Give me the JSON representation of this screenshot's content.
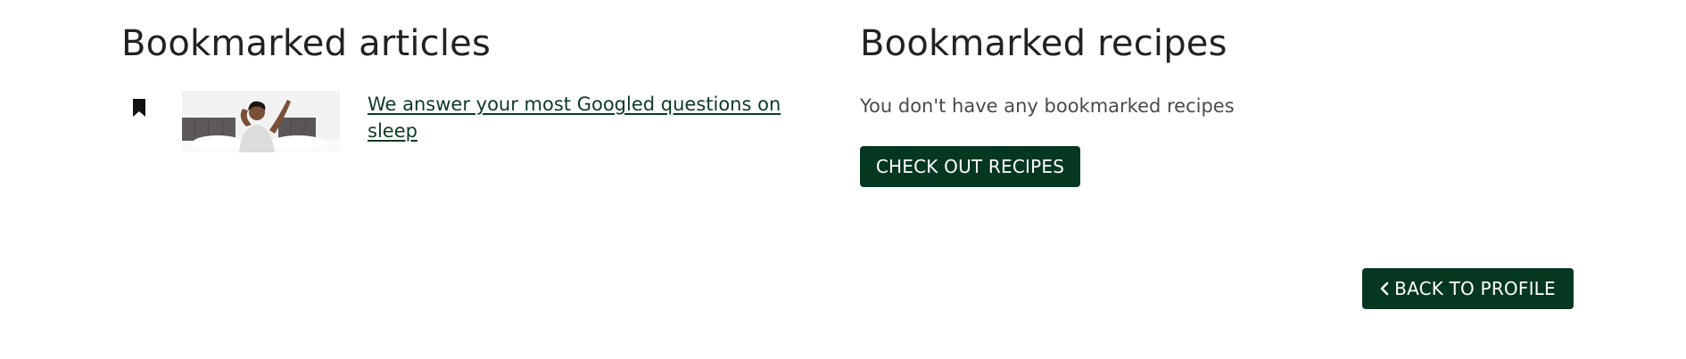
{
  "articles": {
    "heading": "Bookmarked articles",
    "items": [
      {
        "title": "We answer your most Googled questions on sleep",
        "icon": "bookmark-icon",
        "image": "man-stretching-in-bed-image"
      }
    ]
  },
  "recipes": {
    "heading": "Bookmarked recipes",
    "empty_message": "You don't have any bookmarked recipes",
    "cta_label": "CHECK OUT RECIPES"
  },
  "footer": {
    "back_label": "BACK TO PROFILE",
    "back_icon": "chevron-left-icon"
  },
  "colors": {
    "primary": "#063721",
    "link": "#0c3a22",
    "text": "#222222",
    "muted": "#4a4a4a"
  }
}
